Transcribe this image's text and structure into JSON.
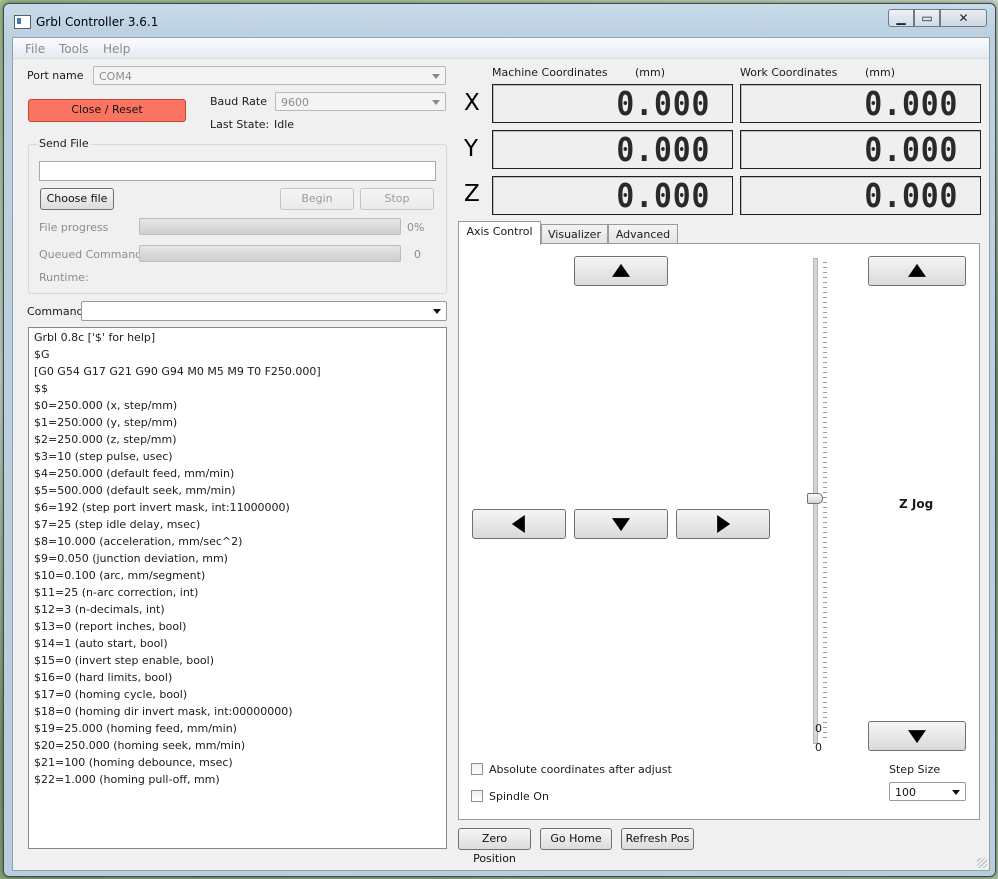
{
  "window": {
    "title": "Grbl Controller 3.6.1"
  },
  "menu": [
    "File",
    "Tools",
    "Help"
  ],
  "port": {
    "label": "Port name",
    "value": "COM4"
  },
  "close_reset_label": "Close / Reset",
  "baud": {
    "label": "Baud Rate",
    "value": "9600"
  },
  "last_state": {
    "label": "Last State:",
    "value": "Idle"
  },
  "send_file": {
    "title": "Send File",
    "path": "",
    "choose_label": "Choose file",
    "begin_label": "Begin",
    "stop_label": "Stop",
    "file_progress_label": "File progress",
    "file_progress_value": "0%",
    "file_progress": 0,
    "queued_label": "Queued Commands",
    "queued_value": "0",
    "runtime_label": "Runtime:"
  },
  "command": {
    "label": "Command",
    "value": ""
  },
  "console_lines": [
    "Grbl 0.8c ['$' for help]",
    "$G",
    "[G0 G54 G17 G21 G90 G94 M0 M5 M9 T0 F250.000]",
    "$$",
    "$0=250.000 (x, step/mm)",
    "$1=250.000 (y, step/mm)",
    "$2=250.000 (z, step/mm)",
    "$3=10 (step pulse, usec)",
    "$4=250.000 (default feed, mm/min)",
    "$5=500.000 (default seek, mm/min)",
    "$6=192 (step port invert mask, int:11000000)",
    "$7=25 (step idle delay, msec)",
    "$8=10.000 (acceleration, mm/sec^2)",
    "$9=0.050 (junction deviation, mm)",
    "$10=0.100 (arc, mm/segment)",
    "$11=25 (n-arc correction, int)",
    "$12=3 (n-decimals, int)",
    "$13=0 (report inches, bool)",
    "$14=1 (auto start, bool)",
    "$15=0 (invert step enable, bool)",
    "$16=0 (hard limits, bool)",
    "$17=0 (homing cycle, bool)",
    "$18=0 (homing dir invert mask, int:00000000)",
    "$19=25.000 (homing feed, mm/min)",
    "$20=250.000 (homing seek, mm/min)",
    "$21=100 (homing debounce, msec)",
    "$22=1.000 (homing pull-off, mm)"
  ],
  "coords": {
    "machine_label": "Machine Coordinates",
    "work_label": "Work Coordinates",
    "unit": "(mm)",
    "axes": [
      {
        "axis": "X",
        "machine": "0.000",
        "work": "0.000"
      },
      {
        "axis": "Y",
        "machine": "0.000",
        "work": "0.000"
      },
      {
        "axis": "Z",
        "machine": "0.000",
        "work": "0.000"
      }
    ]
  },
  "tabs": [
    "Axis Control",
    "Visualizer",
    "Advanced"
  ],
  "axis_control": {
    "z_jog_label": "Z Jog",
    "slider_value_1": "0",
    "slider_value_2": "0",
    "slider_level": 0.5,
    "abs_coords_label": "Absolute coordinates after adjust",
    "spindle_label": "Spindle On",
    "step_size_label": "Step Size",
    "step_size_value": "100"
  },
  "bottom_buttons": {
    "zero": "Zero Position",
    "home": "Go Home",
    "refresh": "Refresh Pos"
  },
  "icons": {
    "up": "arrow-up-icon",
    "down": "arrow-down-icon",
    "left": "arrow-left-icon",
    "right": "arrow-right-icon"
  },
  "colors": {
    "reset_button": "#fa7461"
  }
}
